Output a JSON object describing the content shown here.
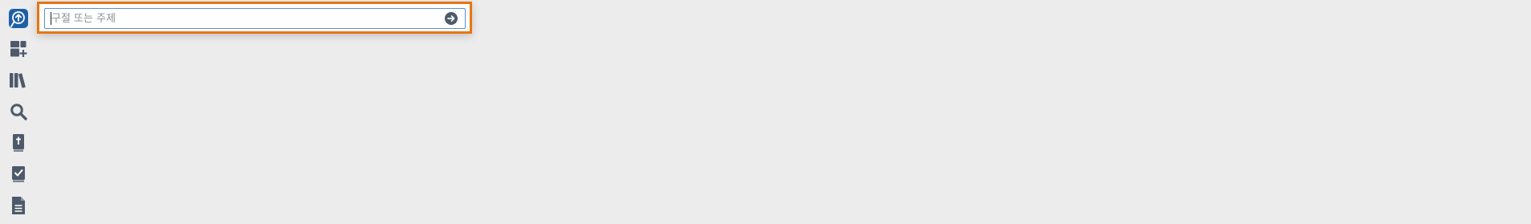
{
  "sidebar": {
    "items": [
      {
        "name": "logo-app-icon",
        "icon": "circle-up-arrow-speech-bubble",
        "color": "#1f5fa8"
      },
      {
        "name": "dashboard-add-icon",
        "icon": "layout-plus"
      },
      {
        "name": "library-icon",
        "icon": "books"
      },
      {
        "name": "search-icon",
        "icon": "magnifier"
      },
      {
        "name": "bible-icon",
        "icon": "book-cross"
      },
      {
        "name": "reading-plan-icon",
        "icon": "book-check"
      },
      {
        "name": "document-icon",
        "icon": "document-lines"
      }
    ],
    "icon_color": "#4e5a6b"
  },
  "search": {
    "placeholder": "구절 또는 주제",
    "value": "",
    "go_icon": "arrow-right-circle-icon",
    "accent_border": "#e87511",
    "focus_border": "#5a8fd6"
  }
}
